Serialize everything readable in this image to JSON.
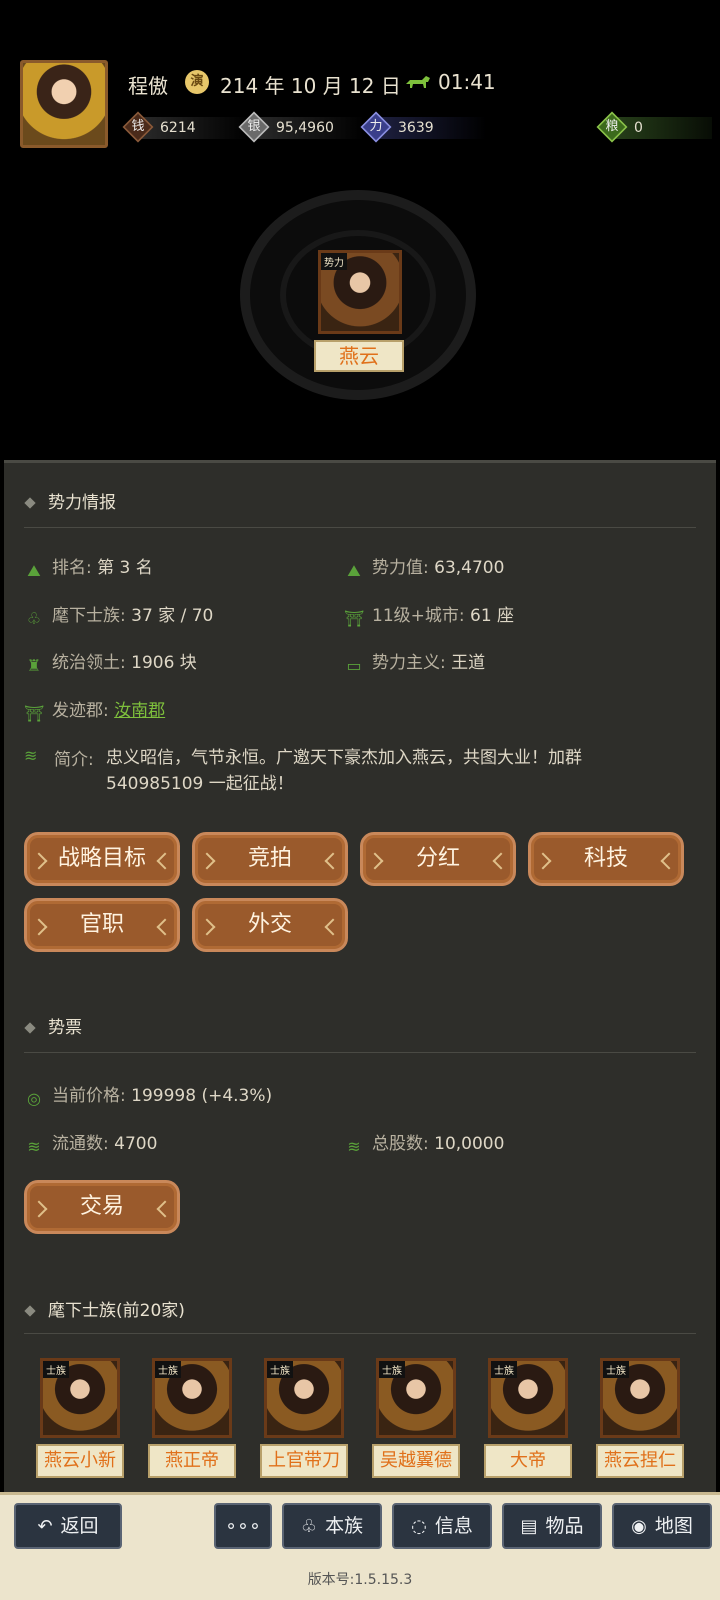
{
  "header": {
    "player_name": "程傲",
    "date_icon": "演",
    "date": "214 年 10 月 12 日",
    "time": "01:41",
    "resources": [
      {
        "icon": "coin-icon",
        "glyph": "钱",
        "value": "6214"
      },
      {
        "icon": "silver-icon",
        "glyph": "银",
        "value": "95,4960"
      },
      {
        "icon": "strength-icon",
        "glyph": "力",
        "value": "3639"
      },
      {
        "icon": "food-icon",
        "glyph": "粮",
        "value": "0"
      }
    ],
    "faction_tag": "势力",
    "faction_name": "燕云"
  },
  "info": {
    "title": "势力情报",
    "rank_label": "排名:",
    "rank_value": "第 3 名",
    "power_label": "势力值:",
    "power_value": "63,4700",
    "clans_label": "麾下士族:",
    "clans_value": "37 家 / 70",
    "cities_label": "11级+城市:",
    "cities_value": "61 座",
    "territory_label": "统治领土:",
    "territory_value": "1906 块",
    "doctrine_label": "势力主义:",
    "doctrine_value": "王道",
    "origin_label": "发迹郡:",
    "origin_value": "汝南郡",
    "intro_label": "简介:",
    "intro_text": "忠义昭信，气节永恒。广邀天下豪杰加入燕云，共图大业！加群540985109 一起征战！"
  },
  "actions": [
    "战略目标",
    "竞拍",
    "分红",
    "科技",
    "官职",
    "外交"
  ],
  "stock": {
    "title": "势票",
    "price_label": "当前价格:",
    "price_value": "199998 (+4.3%)",
    "circulation_label": "流通数:",
    "circulation_value": "4700",
    "total_label": "总股数:",
    "total_value": "10,0000",
    "trade_label": "交易"
  },
  "clans": {
    "title": "麾下士族(前20家)",
    "tag": "士族",
    "items": [
      "燕云小新",
      "燕正帝",
      "上官带刀",
      "吴越翼德",
      "大帝",
      "燕云捏仁"
    ]
  },
  "nav": {
    "back": "返回",
    "more": "∘∘∘",
    "clan": "本族",
    "info": "信息",
    "items": "物品",
    "map": "地图",
    "version": "版本号:1.5.15.3"
  }
}
